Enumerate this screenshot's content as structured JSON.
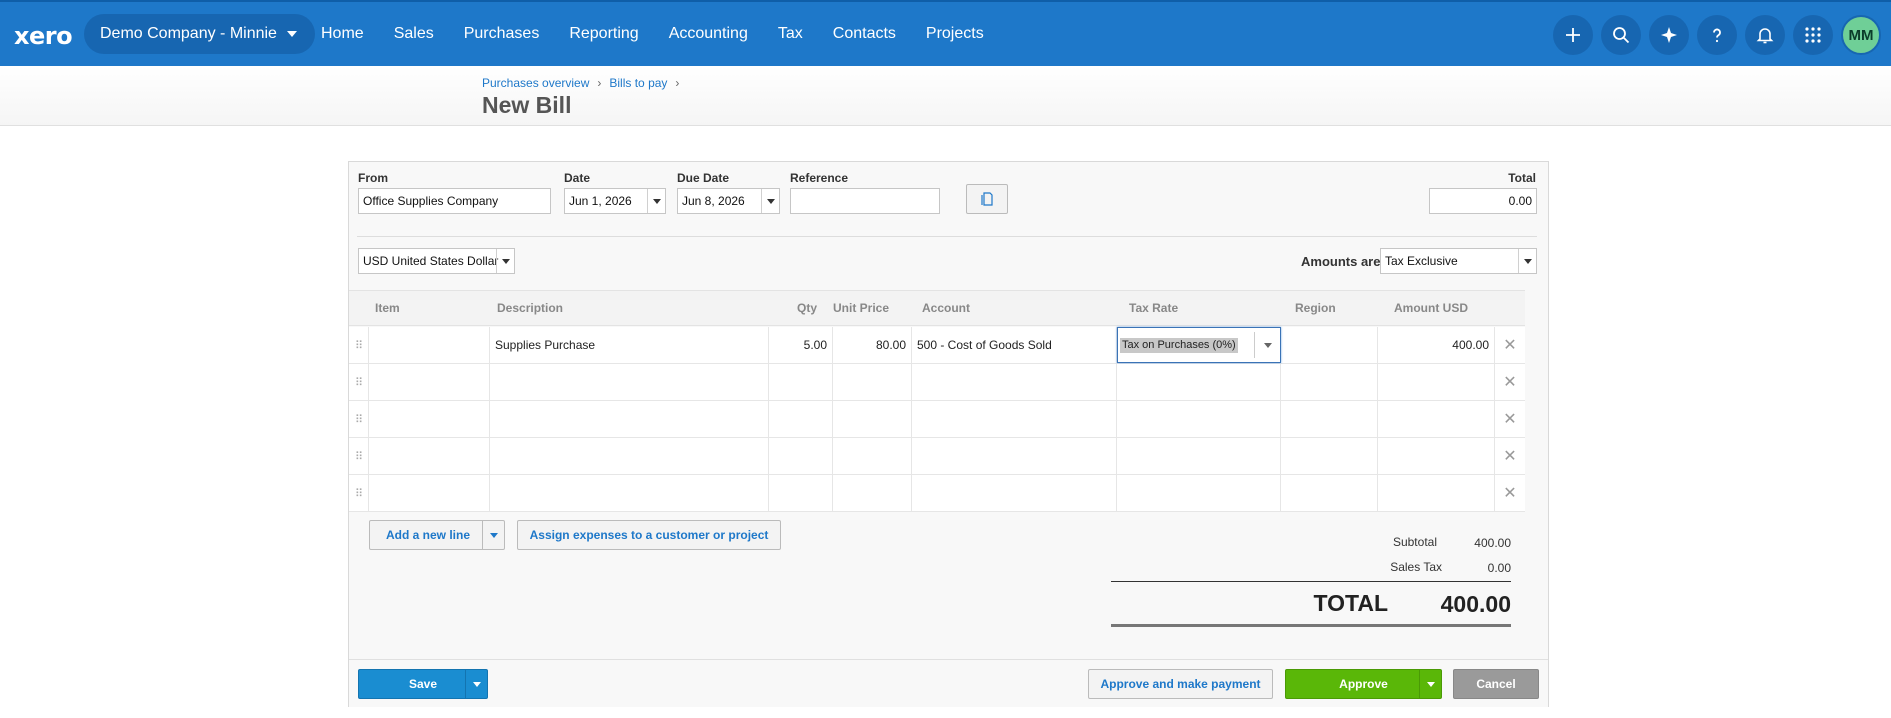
{
  "nav": {
    "logo": "xero",
    "org": "Demo Company - Minnie",
    "menu": [
      "Home",
      "Sales",
      "Purchases",
      "Reporting",
      "Accounting",
      "Tax",
      "Contacts",
      "Projects"
    ],
    "avatar": "MM",
    "icons": [
      "plus-icon",
      "search-icon",
      "sparkle-icon",
      "help-icon",
      "bell-icon",
      "apps-grid-icon"
    ]
  },
  "breadcrumb": [
    "Purchases overview",
    "Bills to pay"
  ],
  "page_title": "New Bill",
  "form": {
    "from_label": "From",
    "from_value": "Office Supplies Company",
    "date_label": "Date",
    "date_value": "Jun 1, 2026",
    "due_label": "Due Date",
    "due_value": "Jun 8, 2026",
    "ref_label": "Reference",
    "ref_value": "",
    "total_label": "Total",
    "total_value": "0.00",
    "currency": "USD United States Dollar",
    "amounts_label": "Amounts are",
    "amounts_value": "Tax Exclusive"
  },
  "table": {
    "headers": [
      "Item",
      "Description",
      "Qty",
      "Unit Price",
      "Account",
      "Tax Rate",
      "Region",
      "Amount USD"
    ],
    "rows": [
      {
        "item": "",
        "description": "Supplies Purchase",
        "qty": "5.00",
        "price": "80.00",
        "account": "500 - Cost of Goods Sold",
        "tax": "Tax on Purchases (0%)",
        "region": "",
        "amount": "400.00"
      },
      {
        "item": "",
        "description": "",
        "qty": "",
        "price": "",
        "account": "",
        "tax": "",
        "region": "",
        "amount": ""
      },
      {
        "item": "",
        "description": "",
        "qty": "",
        "price": "",
        "account": "",
        "tax": "",
        "region": "",
        "amount": ""
      },
      {
        "item": "",
        "description": "",
        "qty": "",
        "price": "",
        "account": "",
        "tax": "",
        "region": "",
        "amount": ""
      },
      {
        "item": "",
        "description": "",
        "qty": "",
        "price": "",
        "account": "",
        "tax": "",
        "region": "",
        "amount": ""
      }
    ]
  },
  "actions": {
    "add_line": "Add a new line",
    "assign": "Assign expenses to a customer or project"
  },
  "totals": {
    "subtotal_label": "Subtotal",
    "subtotal": "400.00",
    "tax_label": "Sales Tax",
    "tax": "0.00",
    "total_label": "TOTAL",
    "total": "400.00"
  },
  "footer": {
    "save": "Save",
    "approve_pay": "Approve and make payment",
    "approve": "Approve",
    "cancel": "Cancel"
  }
}
